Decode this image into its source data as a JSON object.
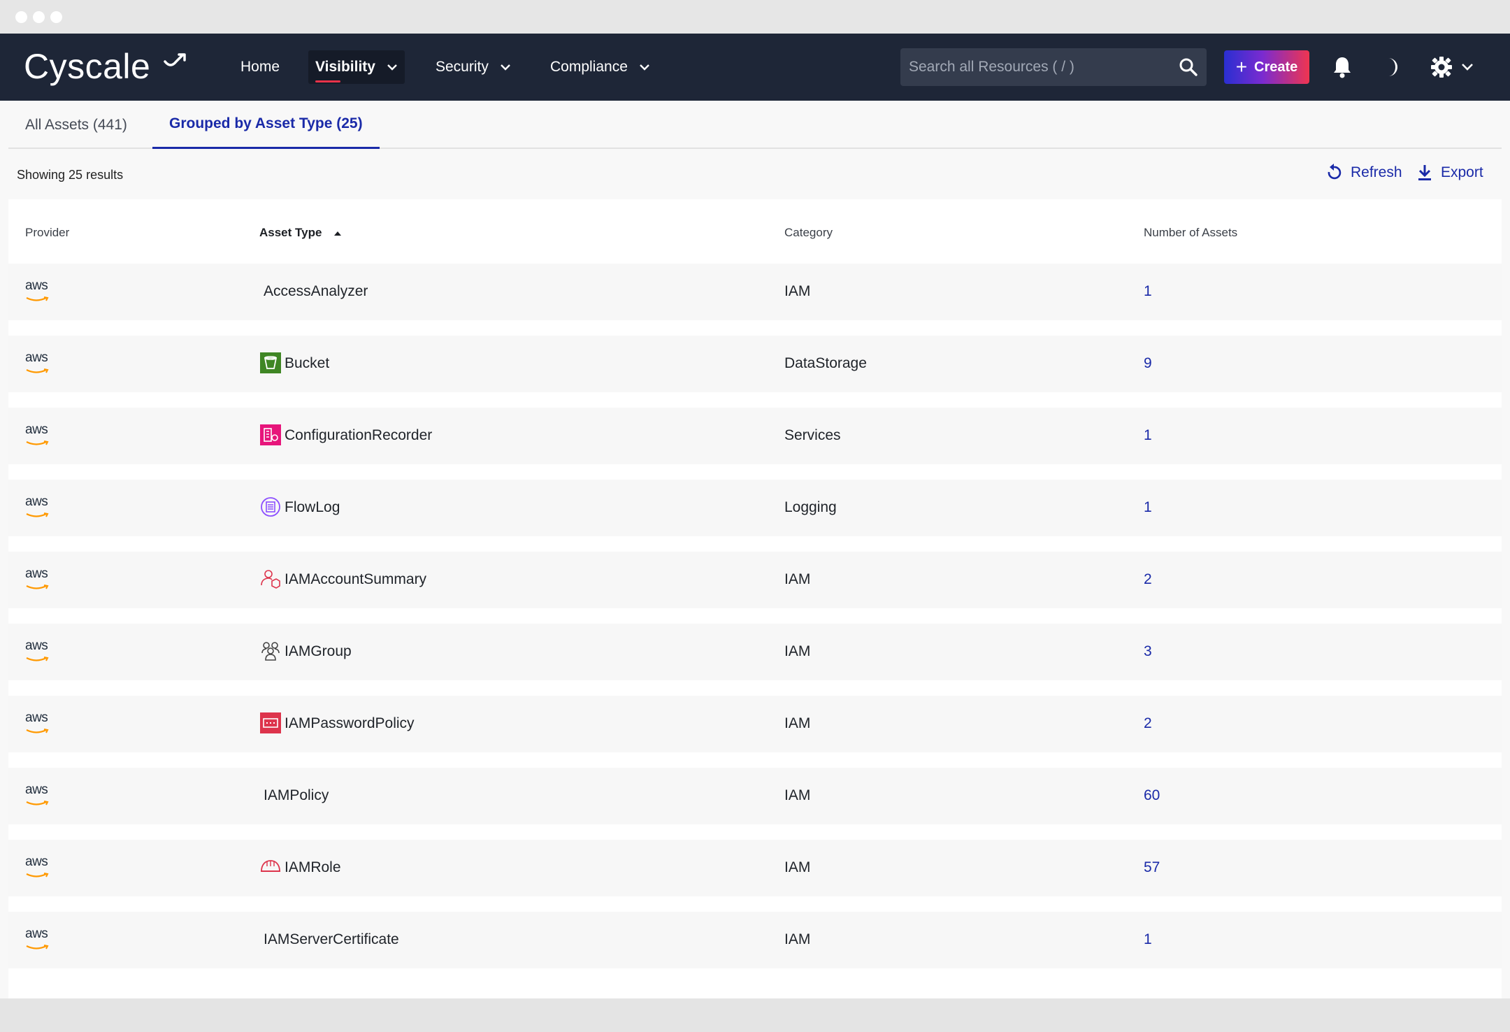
{
  "brand": {
    "name": "Cyscale"
  },
  "nav": {
    "items": [
      {
        "label": "Home",
        "has_dropdown": false,
        "active": false
      },
      {
        "label": "Visibility",
        "has_dropdown": true,
        "active": true
      },
      {
        "label": "Security",
        "has_dropdown": true,
        "active": false
      },
      {
        "label": "Compliance",
        "has_dropdown": true,
        "active": false
      }
    ],
    "search_placeholder": "Search all Resources ( / )",
    "create_label": "Create"
  },
  "tabs": [
    {
      "label": "All Assets (441)",
      "active": false
    },
    {
      "label": "Grouped by Asset Type (25)",
      "active": true
    }
  ],
  "toolbar": {
    "results_text": "Showing 25 results",
    "refresh_label": "Refresh",
    "export_label": "Export"
  },
  "table": {
    "headers": {
      "provider": "Provider",
      "asset_type": "Asset Type",
      "category": "Category",
      "count": "Number of Assets"
    },
    "sort": {
      "column": "asset_type",
      "direction": "ascending"
    },
    "rows": [
      {
        "provider": "aws",
        "asset_type": "AccessAnalyzer",
        "icon": "none",
        "category": "IAM",
        "count": "1"
      },
      {
        "provider": "aws",
        "asset_type": "Bucket",
        "icon": "bucket-icon",
        "category": "DataStorage",
        "count": "9"
      },
      {
        "provider": "aws",
        "asset_type": "ConfigurationRecorder",
        "icon": "configuration-recorder-icon",
        "category": "Services",
        "count": "1"
      },
      {
        "provider": "aws",
        "asset_type": "FlowLog",
        "icon": "flow-log-icon",
        "category": "Logging",
        "count": "1"
      },
      {
        "provider": "aws",
        "asset_type": "IAMAccountSummary",
        "icon": "account-summary-icon",
        "category": "IAM",
        "count": "2"
      },
      {
        "provider": "aws",
        "asset_type": "IAMGroup",
        "icon": "group-icon",
        "category": "IAM",
        "count": "3"
      },
      {
        "provider": "aws",
        "asset_type": "IAMPasswordPolicy",
        "icon": "password-policy-icon",
        "category": "IAM",
        "count": "2"
      },
      {
        "provider": "aws",
        "asset_type": "IAMPolicy",
        "icon": "none",
        "category": "IAM",
        "count": "60"
      },
      {
        "provider": "aws",
        "asset_type": "IAMRole",
        "icon": "role-icon",
        "category": "IAM",
        "count": "57"
      },
      {
        "provider": "aws",
        "asset_type": "IAMServerCertificate",
        "icon": "none",
        "category": "IAM",
        "count": "1"
      }
    ]
  },
  "colors": {
    "navbar_bg": "#1e2637",
    "accent_blue": "#1a2aa8",
    "accent_red": "#e8334a",
    "create_gradient": [
      "#2a2fd1",
      "#7a2bd0",
      "#ef3550"
    ]
  }
}
